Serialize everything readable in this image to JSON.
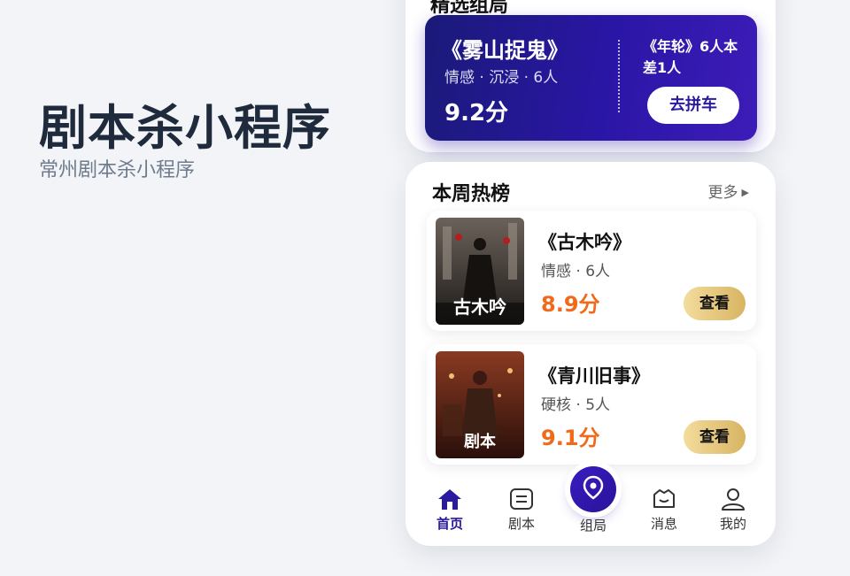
{
  "hero": {
    "title": "剧本杀小程序",
    "subtitle": "常州剧本杀小程序"
  },
  "top_section": {
    "title": "精选组局",
    "promo": {
      "name": "《雾山捉鬼》",
      "tags": "情感 · 沉浸 · 6人",
      "score": "9.2分",
      "need": "《年轮》6人本差1人",
      "button": "去拼车"
    }
  },
  "weekly": {
    "title": "本周热榜",
    "more": "更多",
    "items": [
      {
        "name": "《古木吟》",
        "tags": "情感 · 6人",
        "score": "8.9分",
        "button": "查看",
        "cover_text": "古木吟"
      },
      {
        "name": "《青川旧事》",
        "tags": "硬核 · 5人",
        "score": "9.1分",
        "button": "查看",
        "cover_text": "剧本"
      }
    ]
  },
  "tabbar": {
    "items": [
      {
        "label": "首页",
        "icon": "home-icon",
        "active": true
      },
      {
        "label": "剧本",
        "icon": "script-icon"
      },
      {
        "label": "组局",
        "icon": "location-pin-icon"
      },
      {
        "label": "消息",
        "icon": "message-icon"
      },
      {
        "label": "我的",
        "icon": "user-icon"
      }
    ]
  },
  "colors": {
    "brand": "#2a1aa0",
    "score": "#f06a1a",
    "button_gold": "#d8b462"
  }
}
